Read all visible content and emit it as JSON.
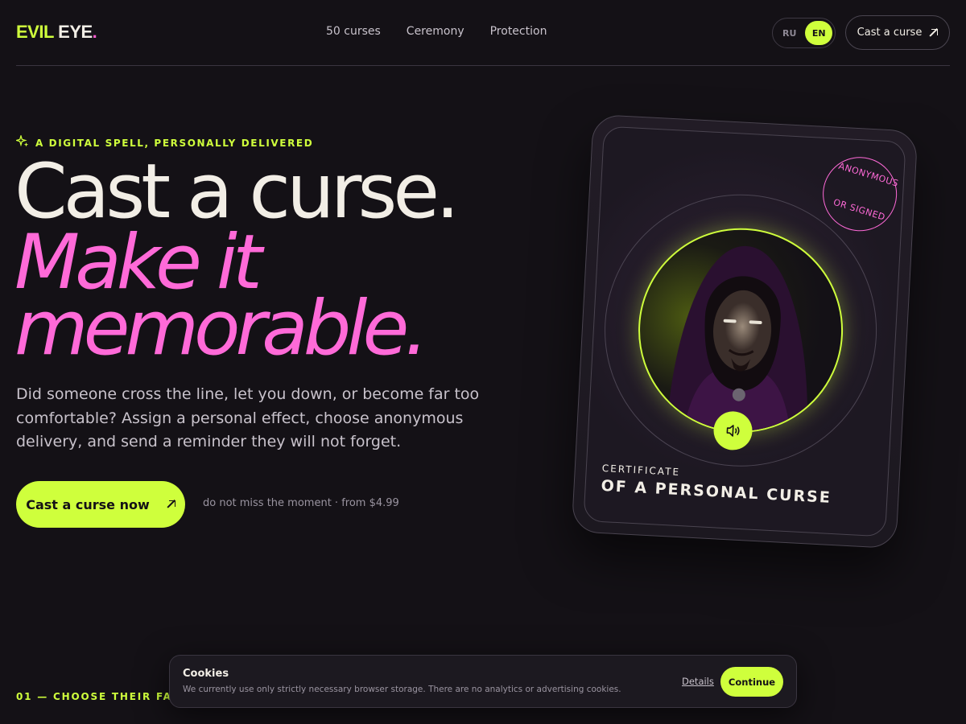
{
  "header": {
    "logo": {
      "part1": "EVIL",
      "part2": "EYE",
      "dot": "."
    },
    "nav": [
      "50 curses",
      "Ceremony",
      "Protection"
    ],
    "lang": {
      "ru": "RU",
      "en": "EN",
      "active": "EN"
    },
    "cta": "Cast a curse"
  },
  "hero": {
    "eyebrow": "A DIGITAL SPELL, PERSONALLY DELIVERED",
    "title_line1": "Cast a curse.",
    "title_line2": "Make it",
    "title_line3": "memorable.",
    "lead": "Did someone cross the line, let you down, or become far too comfortable? Assign a personal effect, choose anonymous delivery, and send a reminder they will not forget.",
    "button": "Cast a curse now",
    "note": "do not miss the moment · from $4.99"
  },
  "card": {
    "stamp_top": "ANONYMOUS",
    "stamp_bottom": "OR SIGNED",
    "certificate_label": "CERTIFICATE",
    "certificate_title": "OF A PERSONAL CURSE"
  },
  "section": {
    "label": "01 — CHOOSE THEIR FATE"
  },
  "cookie": {
    "title": "Cookies",
    "text": "We currently use only strictly necessary browser storage. There are no analytics or advertising cookies.",
    "details": "Details",
    "continue": "Continue"
  },
  "colors": {
    "accent": "#cfff3c",
    "pink": "#ff6ad8",
    "background": "#141116"
  }
}
